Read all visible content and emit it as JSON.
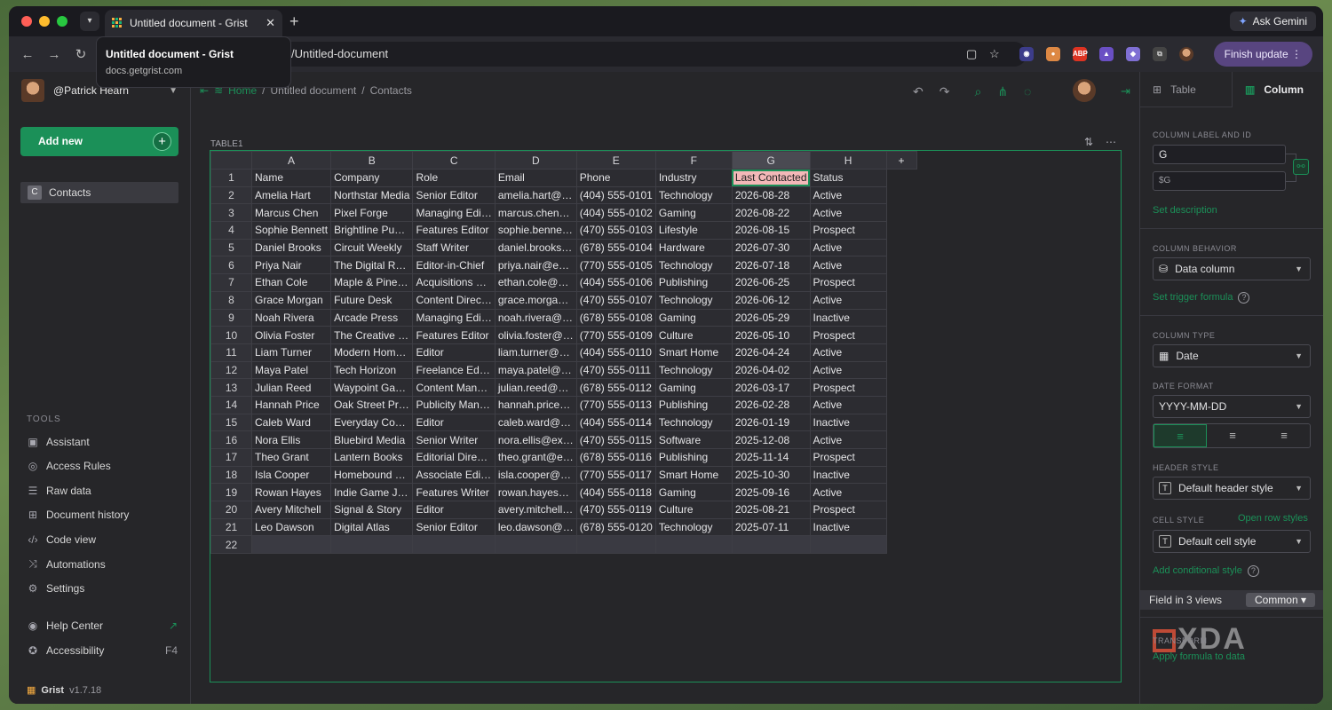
{
  "browser": {
    "tab_title": "Untitled document - Grist",
    "tooltip_title": "Untitled document - Grist",
    "tooltip_url": "docs.getgrist.com",
    "url_path": "/Untitled-document",
    "ask_gemini": "Ask Gemini",
    "finish_update": "Finish update",
    "ext_abp": "ABP"
  },
  "sidebar": {
    "user": "@Patrick Hearn",
    "add_new": "Add new",
    "page_icon": "C",
    "page": "Contacts",
    "tools_header": "TOOLS",
    "tools": [
      "Assistant",
      "Access Rules",
      "Raw data",
      "Document history",
      "Code view",
      "Automations",
      "Settings"
    ],
    "help_center": "Help Center",
    "accessibility": "Accessibility",
    "accessibility_key": "F4",
    "brand": "Grist",
    "version": "v1.7.18"
  },
  "breadcrumb": {
    "home": "Home",
    "doc": "Untitled document",
    "page": "Contacts"
  },
  "widget": {
    "title": "TABLE1"
  },
  "table": {
    "col_letters": [
      "A",
      "B",
      "C",
      "D",
      "E",
      "F",
      "G",
      "H"
    ],
    "add_col": "+",
    "headers": [
      "Name",
      "Company",
      "Role",
      "Email",
      "Phone",
      "Industry",
      "Last Contacted",
      "Status"
    ],
    "rows": [
      [
        "Amelia Hart",
        "Northstar Media",
        "Senior Editor",
        "amelia.hart@…",
        "(404) 555-0101",
        "Technology",
        "2026-08-28",
        "Active"
      ],
      [
        "Marcus Chen",
        "Pixel Forge",
        "Managing Edi…",
        "marcus.chen…",
        "(404) 555-0102",
        "Gaming",
        "2026-08-22",
        "Active"
      ],
      [
        "Sophie Bennett",
        "Brightline Pu…",
        "Features Editor",
        "sophie.benne…",
        "(470) 555-0103",
        "Lifestyle",
        "2026-08-15",
        "Prospect"
      ],
      [
        "Daniel Brooks",
        "Circuit Weekly",
        "Staff Writer",
        "daniel.brooks…",
        "(678) 555-0104",
        "Hardware",
        "2026-07-30",
        "Active"
      ],
      [
        "Priya Nair",
        "The Digital R…",
        "Editor-in-Chief",
        "priya.nair@e…",
        "(770) 555-0105",
        "Technology",
        "2026-07-18",
        "Active"
      ],
      [
        "Ethan Cole",
        "Maple & Pine…",
        "Acquisitions …",
        "ethan.cole@…",
        "(404) 555-0106",
        "Publishing",
        "2026-06-25",
        "Prospect"
      ],
      [
        "Grace Morgan",
        "Future Desk",
        "Content Direc…",
        "grace.morga…",
        "(470) 555-0107",
        "Technology",
        "2026-06-12",
        "Active"
      ],
      [
        "Noah Rivera",
        "Arcade Press",
        "Managing Edi…",
        "noah.rivera@…",
        "(678) 555-0108",
        "Gaming",
        "2026-05-29",
        "Inactive"
      ],
      [
        "Olivia Foster",
        "The Creative …",
        "Features Editor",
        "olivia.foster@…",
        "(770) 555-0109",
        "Culture",
        "2026-05-10",
        "Prospect"
      ],
      [
        "Liam Turner",
        "Modern Hom…",
        "Editor",
        "liam.turner@…",
        "(404) 555-0110",
        "Smart Home",
        "2026-04-24",
        "Active"
      ],
      [
        "Maya Patel",
        "Tech Horizon",
        "Freelance Ed…",
        "maya.patel@…",
        "(470) 555-0111",
        "Technology",
        "2026-04-02",
        "Active"
      ],
      [
        "Julian Reed",
        "Waypoint Ga…",
        "Content Man…",
        "julian.reed@…",
        "(678) 555-0112",
        "Gaming",
        "2026-03-17",
        "Prospect"
      ],
      [
        "Hannah Price",
        "Oak Street Pr…",
        "Publicity Man…",
        "hannah.price…",
        "(770) 555-0113",
        "Publishing",
        "2026-02-28",
        "Active"
      ],
      [
        "Caleb Ward",
        "Everyday Co…",
        "Editor",
        "caleb.ward@…",
        "(404) 555-0114",
        "Technology",
        "2026-01-19",
        "Inactive"
      ],
      [
        "Nora Ellis",
        "Bluebird Media",
        "Senior Writer",
        "nora.ellis@ex…",
        "(470) 555-0115",
        "Software",
        "2025-12-08",
        "Active"
      ],
      [
        "Theo Grant",
        "Lantern Books",
        "Editorial Dire…",
        "theo.grant@e…",
        "(678) 555-0116",
        "Publishing",
        "2025-11-14",
        "Prospect"
      ],
      [
        "Isla Cooper",
        "Homebound …",
        "Associate Edi…",
        "isla.cooper@…",
        "(770) 555-0117",
        "Smart Home",
        "2025-10-30",
        "Inactive"
      ],
      [
        "Rowan Hayes",
        "Indie Game J…",
        "Features Writer",
        "rowan.hayes…",
        "(404) 555-0118",
        "Gaming",
        "2025-09-16",
        "Active"
      ],
      [
        "Avery Mitchell",
        "Signal & Story",
        "Editor",
        "avery.mitchell…",
        "(470) 555-0119",
        "Culture",
        "2025-08-21",
        "Prospect"
      ],
      [
        "Leo Dawson",
        "Digital Atlas",
        "Senior Editor",
        "leo.dawson@…",
        "(678) 555-0120",
        "Technology",
        "2025-07-11",
        "Inactive"
      ]
    ],
    "row_numbers": [
      "1",
      "2",
      "3",
      "4",
      "5",
      "6",
      "7",
      "8",
      "9",
      "10",
      "11",
      "12",
      "13",
      "14",
      "15",
      "16",
      "17",
      "18",
      "19",
      "20",
      "21",
      "22"
    ]
  },
  "right_panel": {
    "tab_table": "Table",
    "tab_column": "Column",
    "col_label_header": "COLUMN LABEL AND ID",
    "col_label": "G",
    "col_id": "$G",
    "set_description": "Set description",
    "behavior_header": "COLUMN BEHAVIOR",
    "behavior": "Data column",
    "set_trigger": "Set trigger formula",
    "type_header": "COLUMN TYPE",
    "type": "Date",
    "date_format_header": "DATE FORMAT",
    "date_format": "YYYY-MM-DD",
    "header_style_header": "HEADER STYLE",
    "header_style": "Default header style",
    "cell_style_header": "CELL STYLE",
    "open_row_styles": "Open row styles",
    "cell_style": "Default cell style",
    "add_conditional": "Add conditional style",
    "field_in_views": "Field in 3 views",
    "common": "Common",
    "transform_header": "TRANSFORM",
    "apply_formula": "Apply formula to data",
    "watermark": "XDA"
  }
}
